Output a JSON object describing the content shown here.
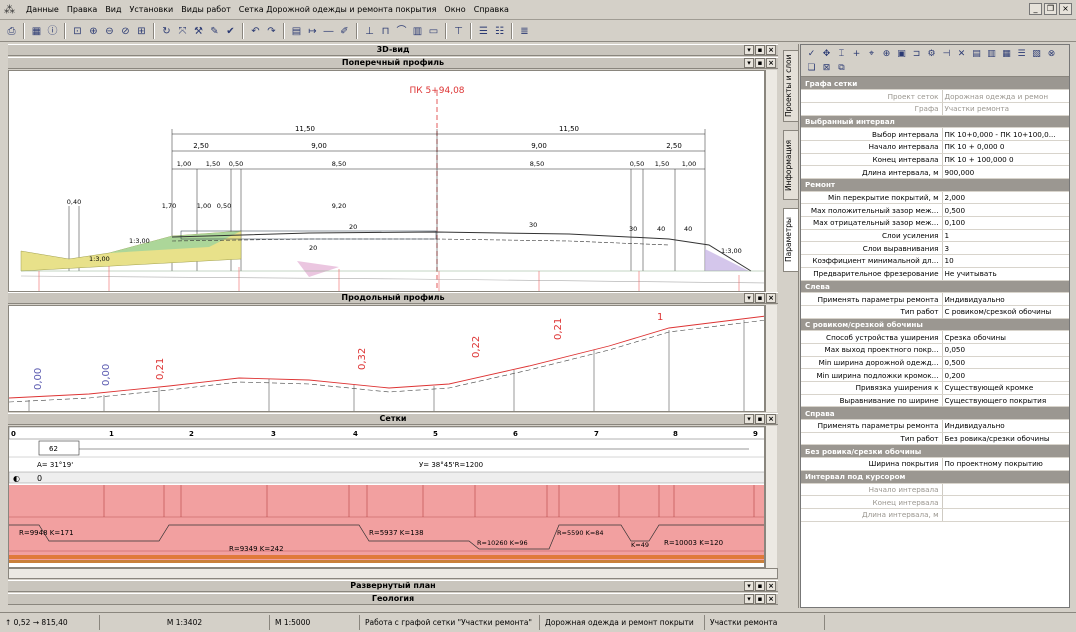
{
  "menu": [
    "Данные",
    "Правка",
    "Вид",
    "Установки",
    "Виды работ",
    "Сетка Дорожной одежды и ремонта покрытия",
    "Окно",
    "Справка"
  ],
  "panels": {
    "view3d": "3D-вид",
    "cross": "Поперечный профиль",
    "longitudinal": "Продольный профиль",
    "grids": "Сетки",
    "plan": "Развернутый план",
    "geology": "Геология"
  },
  "cross_section": {
    "station": "ПК  5+94,08",
    "dims_top": [
      "11,50",
      "11,50"
    ],
    "dims_row2": [
      "2,50",
      "9,00",
      "9,00",
      "2,50"
    ],
    "dims_row3": [
      "1,00",
      "1,50",
      "0,50",
      "8,50",
      "8,50",
      "0,50",
      "1,50",
      "1,00"
    ],
    "left_small": [
      "0,40",
      "1,70",
      "1,00",
      "0,50",
      "9,20"
    ],
    "slopes": [
      "20",
      "20",
      "30",
      "30",
      "40",
      "40",
      "1:3,00",
      "1:3,00",
      "1:3,00"
    ]
  },
  "long_profile": {
    "values": [
      "0,00",
      "0,00",
      "0,21",
      "0,32",
      "0,22",
      "0,21",
      "1"
    ]
  },
  "grid_strip": {
    "stations": [
      "0",
      "1",
      "2",
      "3",
      "4",
      "5",
      "6",
      "7",
      "8",
      "9"
    ],
    "curve_label": "62",
    "angle1": "A= 31°19'",
    "angle2": "У= 38°45'R=1200",
    "row_label": "0",
    "vertical_curves": [
      "R=9948 K=171",
      "R=9349 K=242",
      "R=5937 K=138",
      "R=10260 K=96",
      "R=5590 K=84",
      "K=49",
      "R=10003 K=120"
    ]
  },
  "vertical_tabs": [
    "Проекты и слои",
    "Информация",
    "Параметры"
  ],
  "properties": [
    {
      "type": "sec",
      "k": "Графа сетки"
    },
    {
      "type": "dim",
      "k": "Проект сеток",
      "v": "Дорожная одежда и ремон"
    },
    {
      "type": "dim",
      "k": "Графа",
      "v": "Участки ремонта"
    },
    {
      "type": "sec",
      "k": "Выбранный интервал"
    },
    {
      "type": "row",
      "k": "Выбор интервала",
      "v": "ПК 10+0,000 - ПК 10+100,0..."
    },
    {
      "type": "row",
      "k": "Начало интервала",
      "v": "ПК    10  +  0,000  0"
    },
    {
      "type": "row",
      "k": "Конец интервала",
      "v": "ПК    10  +  100,000  0"
    },
    {
      "type": "row",
      "k": "Длина интервала, м",
      "v": "900,000"
    },
    {
      "type": "sec",
      "k": "Ремонт"
    },
    {
      "type": "row",
      "k": "Min перекрытие покрытий, м",
      "v": "2,000"
    },
    {
      "type": "row",
      "k": "Max положительный зазор меж...",
      "v": "0,500"
    },
    {
      "type": "row",
      "k": "Max отрицательный зазор меж...",
      "v": "0,100"
    },
    {
      "type": "row",
      "k": "Слои усиления",
      "v": "1"
    },
    {
      "type": "row",
      "k": "Слои выравнивания",
      "v": "3"
    },
    {
      "type": "row",
      "k": "Коэффициент минимальной дл...",
      "v": "10"
    },
    {
      "type": "row",
      "k": "Предварительное фрезерование",
      "v": "Не учитывать"
    },
    {
      "type": "sec",
      "k": "Слева"
    },
    {
      "type": "row",
      "k": "Применять параметры ремонта",
      "v": "Индивидуально"
    },
    {
      "type": "row",
      "k": "Тип работ",
      "v": "С ровиком/срезкой обочины"
    },
    {
      "type": "sec",
      "k": "С ровиком/срезкой обочины"
    },
    {
      "type": "row",
      "k": "Способ устройства уширения",
      "v": "Срезка обочины"
    },
    {
      "type": "row",
      "k": "Max выход проектного покр...",
      "v": "0,050"
    },
    {
      "type": "row",
      "k": "Min ширина дорожной одежд...",
      "v": "0,500"
    },
    {
      "type": "row",
      "k": "Min ширина подложки кромок...",
      "v": "0,200"
    },
    {
      "type": "row",
      "k": "Привязка уширения к",
      "v": "Существующей кромке"
    },
    {
      "type": "row",
      "k": "Выравнивание по ширине",
      "v": "Существующего покрытия"
    },
    {
      "type": "sec",
      "k": "Справа"
    },
    {
      "type": "row",
      "k": "Применять параметры ремонта",
      "v": "Индивидуально"
    },
    {
      "type": "row",
      "k": "Тип работ",
      "v": "Без ровика/срезки обочины"
    },
    {
      "type": "sec",
      "k": "Без ровика/срезки обочины"
    },
    {
      "type": "row",
      "k": "Ширина покрытия",
      "v": "По проектному покрытию"
    },
    {
      "type": "sec",
      "k": "Интервал под курсором"
    },
    {
      "type": "dim",
      "k": "Начало интервала",
      "v": ""
    },
    {
      "type": "dim",
      "k": "Конец интервала",
      "v": ""
    },
    {
      "type": "dim",
      "k": "Длина интервала, м",
      "v": ""
    }
  ],
  "status": {
    "coords": "↑ 0,52   → 815,40",
    "scale1": "M 1:3402",
    "scale2": "M 1:5000",
    "mode": "Работа с графой сетки \"Участки ремонта\"",
    "project": "Дорожная одежда и ремонт покрыти",
    "layer": "Участки ремонта"
  },
  "colors": {
    "accent": "#c0392b",
    "pink": "#f2a0a0",
    "sec": "#9b9791"
  }
}
